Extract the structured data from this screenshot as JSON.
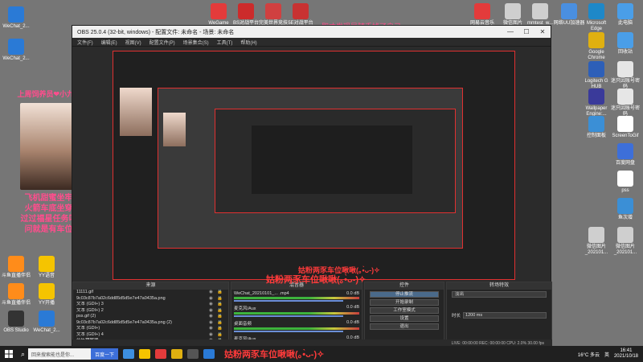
{
  "desktop": {
    "left_icons": [
      {
        "label": "WeChat_2...",
        "color": "#2a7ad6"
      },
      {
        "label": "WeChat_2...",
        "color": "#2a7ad6"
      }
    ],
    "left_bottom_icons": [
      {
        "label": "斗鱼直播伴侣",
        "color": "#ff8c1a"
      },
      {
        "label": "YY语音",
        "color": "#f5c400"
      },
      {
        "label": "斗鱼直播伴侣",
        "color": "#ff8c1a"
      },
      {
        "label": "YY开播",
        "color": "#f5c400"
      },
      {
        "label": "OBS Studio",
        "color": "#333333"
      },
      {
        "label": "WeChat_2...",
        "color": "#2a7ad6"
      }
    ],
    "top_icons": [
      {
        "label": "WeGame",
        "color": "#e33b3b"
      },
      {
        "label": "BS对战平台",
        "color": "#cc2b2b"
      },
      {
        "label": "完美世界竞技平台",
        "color": "#d04040"
      },
      {
        "label": "5E对战平台",
        "color": "#c83232"
      }
    ],
    "right_icons": [
      {
        "label": "网易云音乐",
        "color": "#e33b3b"
      },
      {
        "label": "微信图片_2021062...",
        "color": "#cfcfcf"
      },
      {
        "label": "mmtest_w...",
        "color": "#cfcfcf"
      },
      {
        "label": "网络UU加速器",
        "color": "#4a8fe0"
      },
      {
        "label": "Microsoft Edge",
        "color": "#1e88c8"
      },
      {
        "label": "此电脑",
        "color": "#4a9ee8"
      },
      {
        "label": "回收站",
        "color": "#4a9ee8"
      },
      {
        "label": "Google Chrome",
        "color": "#e0b010"
      },
      {
        "label": "迷只因账号密码",
        "color": "#e6e6e6"
      },
      {
        "label": "Logitech G HUB",
        "color": "#2d5fb8"
      },
      {
        "label": "迷只因账号密码",
        "color": "#e6e6e6"
      },
      {
        "label": "Wallpaper Engine:...",
        "color": "#3a3a9a"
      },
      {
        "label": "控制面板",
        "color": "#3b8fd6"
      },
      {
        "label": "ScreenToGif",
        "color": "#ffffff"
      },
      {
        "label": "百度网盘",
        "color": "#3d6fd9"
      },
      {
        "label": "pss",
        "color": "#ffffff"
      },
      {
        "label": "鱼次增",
        "color": "#3b8fd6"
      },
      {
        "label": "微信图片_202101...",
        "color": "#cfcfcf"
      },
      {
        "label": "微信图片_202101...",
        "color": "#cfcfcf"
      }
    ],
    "top_banner": "即才发现是随手掉了自己"
  },
  "streamer": {
    "name": "上周饲养员❤小九❤",
    "caption_lines": [
      "飞机甜蜜坐牢",
      "火箭车底坐穿",
      "过过福星任务叫",
      "问就是有车位"
    ]
  },
  "obs": {
    "title": "OBS 25.0.4 (32-bit, windows) - 配置文件: 未命名 - 场景: 未命名",
    "window_buttons": [
      "—",
      "☐",
      "✕"
    ],
    "menu": [
      "文件(F)",
      "编辑(E)",
      "视图(V)",
      "配置文件(P)",
      "场景集合(S)",
      "工具(T)",
      "帮助(H)"
    ],
    "panels": {
      "scenes": "场景",
      "sources": "来源",
      "mixer": "混音器",
      "controls": "控件",
      "transitions": "转场特效"
    },
    "sources": [
      "11111.gif",
      "9c03c87b7a02c6dd85d5d5e7e47a0435a.png",
      "文本 (GDI+) 3",
      "文本 (GDI+) 2",
      "pss.gif (2)",
      "9c03c87b7a02c6dd85d5d5e7e47a0435a.png (2)",
      "文本 (GDI+)",
      "文本 (GDI+) 4",
      "音乐播放器"
    ],
    "tabs": [
      "来源",
      "场景"
    ],
    "mixer": [
      {
        "name": "WeChat_20210101_... .mp4",
        "db": "0.0 dB"
      },
      {
        "name": "麦克风/Aux",
        "db": "0.0 dB"
      },
      {
        "name": "桌面音频",
        "db": "0.0 dB"
      },
      {
        "name": "麦克风/Aux",
        "db": "0.0 dB"
      }
    ],
    "controls": [
      "停止推流",
      "开始录制",
      "工作室模式",
      "设置",
      "退出"
    ],
    "transition": {
      "type": "淡出",
      "duration_label": "时长",
      "duration": "1200 ms"
    },
    "status": "LIVE: 00:00:00  REC: 00:00:00  CPU: 2.0%  30.00 fps",
    "overlay_text": "姑粉两豕车位啾啾(｡•̀ᴗ-)✧"
  },
  "taskbar": {
    "search_placeholder": "回来搜索能也是你...",
    "search_button": "百度一下",
    "center_text": "姑粉两豕车位啾啾(｡•̀ᴗ-)✧",
    "weather": "16°C 多云",
    "ime": "英",
    "time": "16:41",
    "date": "2021/10/18"
  },
  "accent_red": "#ff3b3b",
  "accent_pink": "#ff4d8d"
}
